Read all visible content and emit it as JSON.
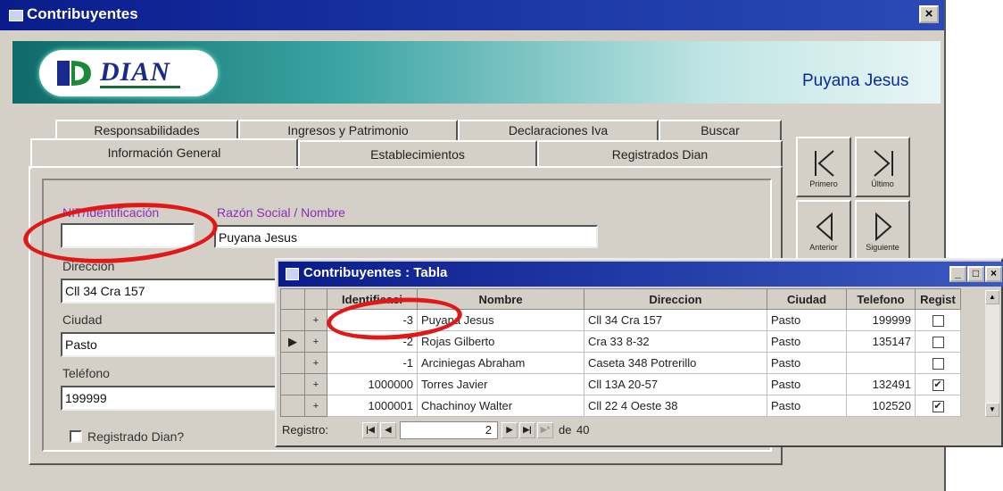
{
  "window": {
    "title": "Contribuyentes",
    "close_glyph": "×"
  },
  "banner": {
    "logo_text": "DIAN",
    "user_name": "Puyana Jesus"
  },
  "tabs_row1": [
    "Responsabilidades",
    "Ingresos y Patrimonio",
    "Declaraciones Iva",
    "Buscar"
  ],
  "tabs_row2": [
    "Información General",
    "Establecimientos",
    "Registrados Dian"
  ],
  "form": {
    "nit_label": "NIT/Identificación",
    "nit_value": "",
    "razon_label": "Razón Social / Nombre",
    "razon_value": "Puyana Jesus",
    "direccion_label": "Direccion",
    "direccion_value": "Cll 34 Cra 157",
    "ciudad_label": "Ciudad",
    "ciudad_value": "Pasto",
    "telefono_label": "Teléfono",
    "telefono_value": "199999",
    "registrado_label": "Registrado Dian?"
  },
  "nav_buttons": {
    "primero": "Primero",
    "ultimo": "Último",
    "anterior": "Anterior",
    "siguiente": "Siguiente"
  },
  "grid": {
    "title": "Contribuyentes : Tabla",
    "columns": [
      "Identificaci",
      "Nombre",
      "Direccion",
      "Ciudad",
      "Telefono",
      "Regist"
    ],
    "rows": [
      {
        "id": "-3",
        "nombre": "Puyana Jesus",
        "direccion": "Cll 34 Cra 157",
        "ciudad": "Pasto",
        "telefono": "199999",
        "registrado": false
      },
      {
        "id": "-2",
        "nombre": "Rojas Gilberto",
        "direccion": "Cra 33 8-32",
        "ciudad": "Pasto",
        "telefono": "135147",
        "registrado": false
      },
      {
        "id": "-1",
        "nombre": "Arciniegas Abraham",
        "direccion": "Caseta 348 Potrerillo",
        "ciudad": "Pasto",
        "telefono": "",
        "registrado": false
      },
      {
        "id": "1000000",
        "nombre": "Torres Javier",
        "direccion": "Cll 13A 20-57",
        "ciudad": "Pasto",
        "telefono": "132491",
        "registrado": true
      },
      {
        "id": "1000001",
        "nombre": "Chachinoy Walter",
        "direccion": "Cll 22 4 Oeste 38",
        "ciudad": "Pasto",
        "telefono": "102520",
        "registrado": true
      }
    ],
    "current_row": 1,
    "record_label": "Registro:",
    "record_current": "2",
    "record_of": "de",
    "record_total": "40"
  }
}
